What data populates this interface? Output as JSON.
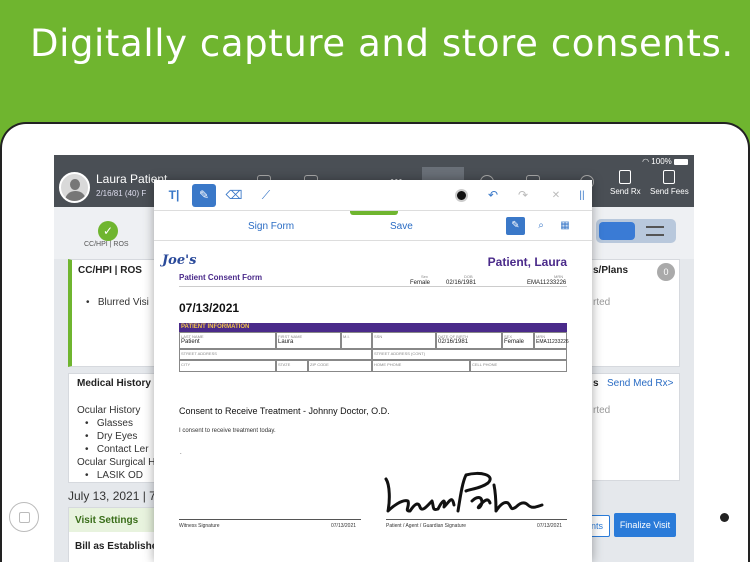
{
  "banner": {
    "title": "Digitally capture and store consents."
  },
  "status_bar": {
    "text": "100%"
  },
  "header": {
    "patient_name": "Laura Patient",
    "patient_sub": "2/16/81 (40) F",
    "send_rx": "Send Rx",
    "send_fees": "Send Fees"
  },
  "stepper": {
    "step_label": "CC/HPI | ROS"
  },
  "background": {
    "cc_title": "CC/HPI | ROS",
    "cc_item": "Blurred Visi",
    "plans_title": "s/Plans",
    "badge": "0",
    "started_1": "rted",
    "medical_title": "Medical History",
    "send_med": "Send Med Rx>",
    "started_2": "rted",
    "ocular_history": "Ocular History",
    "glasses": "Glasses",
    "dry_eyes": "Dry Eyes",
    "contact_lens": "Contact Ler",
    "ocular_surgical": "Ocular Surgical H",
    "lasik": "LASIK OD",
    "visit_date": "July 13, 2021 | 7",
    "visit_settings": "Visit Settings",
    "bill_as": "Bill as Establishe",
    "nts": "nts",
    "finalize": "Finalize Visit"
  },
  "modal": {
    "tools": {
      "text": "T|",
      "pen": "✎",
      "eraser": "⌫",
      "line": "⟋",
      "undo": "↶",
      "redo": "↷",
      "clear": "✕",
      "divider": "||"
    },
    "sign_form": "Sign Form",
    "save": "Save"
  },
  "form": {
    "logo": "Joe's",
    "title": "Patient Consent Form",
    "patient_name": "Patient, Laura",
    "sex_label": "Sex",
    "sex": "Female",
    "dob_label": "DOB",
    "dob": "02/16/1981",
    "mrn_label": "MRN",
    "mrn": "EMA11233226",
    "date": "07/13/2021",
    "section": "PATIENT INFORMATION",
    "last_name_label": "LAST NAME",
    "last_name": "Patient",
    "first_name_label": "FIRST NAME",
    "first_name": "Laura",
    "mi_label": "M.I.",
    "ssn_label": "SSN",
    "dob2_label": "DATE OF BIRTH",
    "dob2": "02/16/1981",
    "sex2_label": "SEX",
    "sex2": "Female",
    "mrn2_label": "MRN",
    "mrn2": "EMA11233226",
    "street_label": "STREET ADDRESS",
    "street2_label": "STREET ADDRESS (CONT)",
    "city_label": "CITY",
    "state_label": "STATE",
    "zip_label": "ZIP CODE",
    "home_phone_label": "HOME PHONE",
    "cell_phone_label": "CELL PHONE",
    "consent_title": "Consent to Receive Treatment - Johnny Doctor, O.D.",
    "consent_body": "I consent to receive treatment today.",
    "witness_label": "Witness Signature",
    "witness_date": "07/13/2021",
    "patient_sig_label": "Patient / Agent / Guardian Signature",
    "patient_sig_date": "07/13/2021"
  }
}
